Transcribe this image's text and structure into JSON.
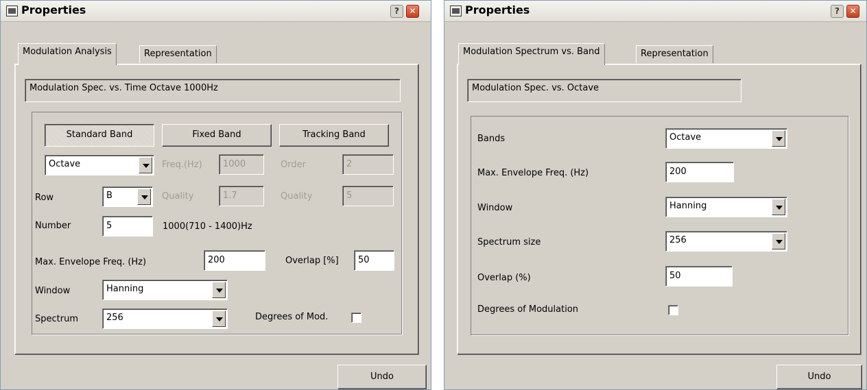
{
  "left": {
    "title": "Properties",
    "tabs": [
      "Modulation  Analysis",
      "Representation"
    ],
    "description": "Modulation Spec. vs. Time Octave 1000Hz",
    "band_buttons": [
      "Standard Band",
      "Fixed Band",
      "Tracking Band"
    ],
    "bands_select": "Octave",
    "freq_label": "Freq.(Hz)",
    "freq_value": "1000",
    "order_label": "Order",
    "order_value": "2",
    "row_label": "Row",
    "row_select": "B",
    "quality_label": "Quality",
    "quality_value": "1.7",
    "quality2_label": "Quality",
    "quality2_value": "5",
    "number_label": "Number",
    "number_value": "5",
    "number_range": "1000(710 - 1400)Hz",
    "max_env_label": "Max. Envelope Freq. (Hz)",
    "max_env_value": "200",
    "overlap_label": "Overlap [%]",
    "overlap_value": "50",
    "window_label": "Window",
    "window_select": "Hanning",
    "spectrum_label": "Spectrum",
    "spectrum_select": "256",
    "degrees_label": "Degrees of Mod.",
    "undo": "Undo"
  },
  "right": {
    "title": "Properties",
    "tabs": [
      "Modulation Spectrum vs. Band",
      "Representation"
    ],
    "description": "Modulation Spec. vs. Octave",
    "bands_label": "Bands",
    "bands_select": "Octave",
    "max_env_label": "Max. Envelope Freq. (Hz)",
    "max_env_value": "200",
    "window_label": "Window",
    "window_select": "Hanning",
    "spectrum_label": "Spectrum size",
    "spectrum_select": "256",
    "overlap_label": "Overlap (%)",
    "overlap_value": "50",
    "degrees_label": "Degrees of Modulation",
    "undo": "Undo"
  },
  "icons": [
    "window-pin-icon",
    "help-icon",
    "close-icon",
    "chevron-down-icon"
  ]
}
